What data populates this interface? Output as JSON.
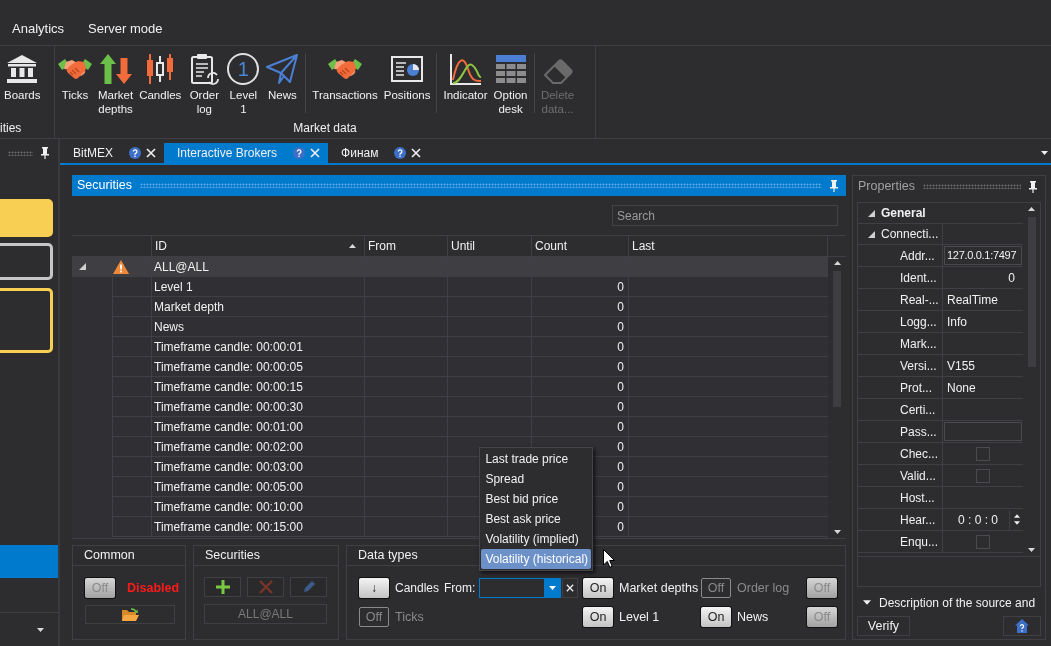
{
  "sidebar": {
    "cards": [
      {
        "kind": "filled",
        "color": "#f9cf53"
      },
      {
        "kind": "outlined",
        "color": "#c6c6c6"
      },
      {
        "kind": "outlined",
        "color": "#f9cf53"
      }
    ],
    "list": [
      {
        "selected": true
      }
    ]
  },
  "menu": [
    {
      "label": "Analytics"
    },
    {
      "label": "Server mode"
    }
  ],
  "ribbon": {
    "groups": [
      {
        "label": "ities",
        "sections": [
          {
            "buttons": [
              {
                "label": "Boards",
                "disabled": false
              }
            ]
          }
        ]
      },
      {
        "label": "Market data",
        "sections": [
          {
            "buttons": [
              {
                "label": "Ticks",
                "disabled": false
              },
              {
                "label": "Market depths",
                "disabled": false
              },
              {
                "label": "Candles",
                "disabled": false
              },
              {
                "label": "Order log",
                "disabled": false
              },
              {
                "label": "Level 1",
                "glyph": "1",
                "disabled": false
              },
              {
                "label": "News",
                "disabled": false
              }
            ]
          },
          {
            "buttons": [
              {
                "label": "Transactions",
                "disabled": false
              },
              {
                "label": "Positions",
                "disabled": false
              }
            ]
          },
          {
            "buttons": [
              {
                "label": "Indicator",
                "disabled": false
              },
              {
                "label": "Option desk",
                "disabled": false
              }
            ]
          },
          {
            "buttons": [
              {
                "label": "Delete data...",
                "disabled": true
              }
            ]
          }
        ]
      }
    ]
  },
  "tabs": [
    {
      "label": "BitMEX",
      "selected": false
    },
    {
      "label": "Interactive Brokers",
      "selected": true
    },
    {
      "label": "Финам",
      "selected": false
    }
  ],
  "securities": {
    "title": "Securities",
    "search": {
      "placeholder": "Search"
    },
    "columns": [
      {
        "label": "ID",
        "sorted": true
      },
      {
        "label": "From",
        "sorted": false
      },
      {
        "label": "Until",
        "sorted": false
      },
      {
        "label": "Count",
        "sorted": false
      },
      {
        "label": "Last",
        "sorted": false
      }
    ],
    "rows": [
      {
        "id": "ALL@ALL",
        "warning": true,
        "expanded": true,
        "selected": true,
        "children": [
          {
            "id": "Level 1",
            "count": "0",
            "selected": false
          },
          {
            "id": "Market depth",
            "count": "0",
            "selected": false
          },
          {
            "id": "News",
            "count": "0",
            "selected": false
          },
          {
            "id": "Timeframe candle: 00:00:01",
            "count": "0",
            "selected": false
          },
          {
            "id": "Timeframe candle: 00:00:05",
            "count": "0",
            "selected": false
          },
          {
            "id": "Timeframe candle: 00:00:15",
            "count": "0",
            "selected": false
          },
          {
            "id": "Timeframe candle: 00:00:30",
            "count": "0",
            "selected": false
          },
          {
            "id": "Timeframe candle: 00:01:00",
            "count": "0",
            "selected": false
          },
          {
            "id": "Timeframe candle: 00:02:00",
            "count": "0",
            "selected": false
          },
          {
            "id": "Timeframe candle: 00:03:00",
            "count": "0",
            "selected": false
          },
          {
            "id": "Timeframe candle: 00:05:00",
            "count": "0",
            "selected": false
          },
          {
            "id": "Timeframe candle: 00:10:00",
            "count": "0",
            "selected": false
          },
          {
            "id": "Timeframe candle: 00:15:00",
            "count": "0",
            "selected": false
          }
        ]
      }
    ]
  },
  "common": {
    "title": "Common",
    "toggle": {
      "state": "Off",
      "on": false,
      "disabled": false
    },
    "status": "Disabled"
  },
  "selection_box": {
    "title": "Securities",
    "actions": [
      {
        "disabled": false
      },
      {
        "disabled": true
      },
      {
        "disabled": true
      }
    ],
    "selection": {
      "label": "ALL@ALL",
      "disabled": true
    }
  },
  "data_types": {
    "title": "Data types",
    "rows": [
      [
        {
          "kind": "candles",
          "button": "↓",
          "label": "Candles",
          "from_label": "From:",
          "options": [
            {
              "label": "Last trade price",
              "selected": false
            },
            {
              "label": "Spread",
              "selected": false
            },
            {
              "label": "Best bid price",
              "selected": false
            },
            {
              "label": "Best ask price",
              "selected": false
            },
            {
              "label": "Volatility (implied)",
              "selected": false
            },
            {
              "label": "Volatility (historical)",
              "selected": true
            }
          ]
        },
        {
          "kind": "toggle",
          "state": "On",
          "on": true,
          "disabled": false,
          "label": "Market depths"
        },
        {
          "kind": "toggle",
          "state": "Off",
          "on": false,
          "disabled": true,
          "label": "Order log"
        },
        {
          "kind": "toggle",
          "state": "Off",
          "on": false,
          "disabled": false
        }
      ],
      [
        {
          "kind": "toggle",
          "state": "Off",
          "on": false,
          "disabled": true,
          "label": "Ticks"
        },
        {
          "kind": "toggle",
          "state": "On",
          "on": true,
          "disabled": false,
          "label": "Level 1"
        },
        {
          "kind": "toggle",
          "state": "On",
          "on": true,
          "disabled": false,
          "label": "News"
        },
        {
          "kind": "toggle",
          "state": "Off",
          "on": false,
          "disabled": false
        }
      ]
    ]
  },
  "properties": {
    "title": "Properties",
    "grid": [
      {
        "label": "General",
        "expanded": true,
        "children": [
          {
            "label": "Connecti...",
            "expanded": true,
            "children": [
              {
                "name": "Addr...",
                "kind": "textbox",
                "value": "127.0.0.1:7497"
              },
              {
                "name": "Ident...",
                "kind": "number",
                "value": "0"
              },
              {
                "name": "Real-...",
                "kind": "text",
                "value": "RealTime"
              },
              {
                "name": "Logg...",
                "kind": "text",
                "value": "Info"
              },
              {
                "name": "Mark...",
                "kind": "text"
              },
              {
                "name": "Versi...",
                "kind": "text",
                "value": "V155"
              },
              {
                "name": "Prot...",
                "kind": "text",
                "value": "None"
              },
              {
                "name": "Certi...",
                "kind": "text"
              },
              {
                "name": "Pass...",
                "kind": "textbox"
              },
              {
                "name": "Chec...",
                "kind": "checkbox",
                "checked": false
              },
              {
                "name": "Valid...",
                "kind": "checkbox",
                "checked": false
              },
              {
                "name": "Host...",
                "kind": "text"
              },
              {
                "name": "Hear...",
                "kind": "timespan",
                "value": "0 : 0 : 0"
              },
              {
                "name": "Enqu...",
                "kind": "checkbox",
                "checked": false
              }
            ]
          }
        ]
      }
    ],
    "description": {
      "label": "Description of the source and"
    },
    "verify_button": "Verify"
  }
}
